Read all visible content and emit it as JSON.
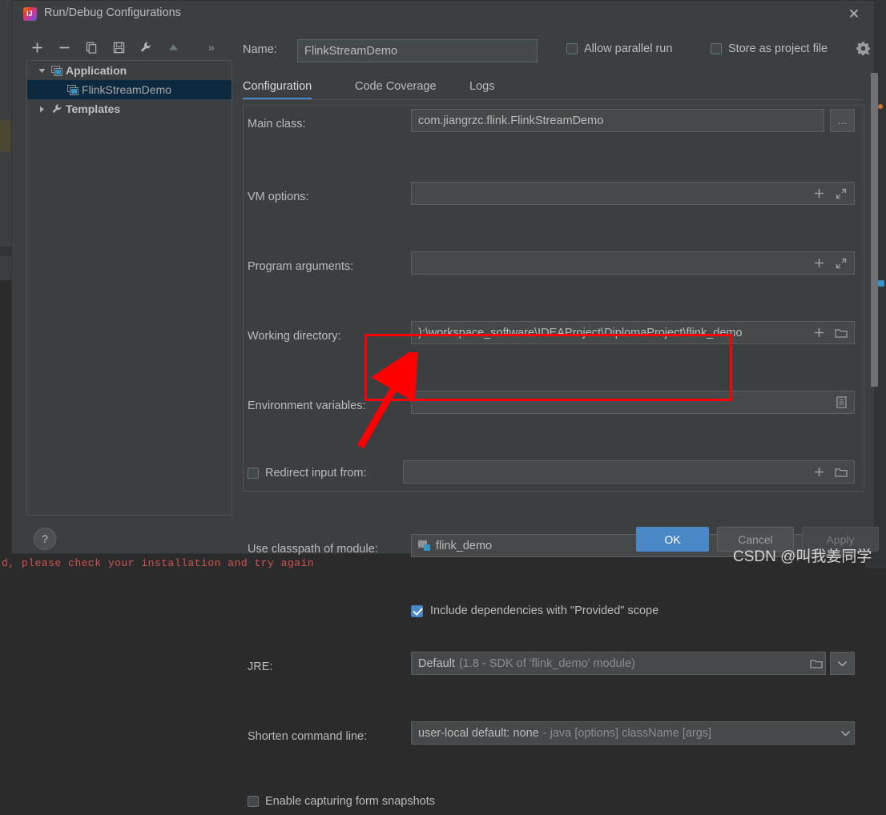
{
  "window": {
    "title": "Run/Debug Configurations",
    "app_icon": "intellij-idea-icon",
    "close_icon": "close-icon"
  },
  "toolbar": {
    "icons": [
      "add-icon",
      "remove-icon",
      "copy-icon",
      "save-icon",
      "wrench-icon",
      "move-up-icon"
    ],
    "overflow_label": "»"
  },
  "tree": {
    "items": [
      {
        "label": "Application",
        "icon": "application-icon",
        "twisty": "expanded",
        "level": 0,
        "selected": false
      },
      {
        "label": "FlinkStreamDemo",
        "icon": "run-config-icon",
        "twisty": "none",
        "level": 1,
        "selected": true
      },
      {
        "label": "Templates",
        "icon": "wrench-icon",
        "twisty": "collapsed",
        "level": 0,
        "selected": false
      }
    ]
  },
  "header": {
    "name_label": "Name:",
    "name_value": "FlinkStreamDemo",
    "allow_parallel_run": {
      "label": "Allow parallel run",
      "checked": false
    },
    "store_as_project_file": {
      "label": "Store as project file",
      "checked": false
    },
    "gear_icon": "gear-icon"
  },
  "tabs": [
    {
      "label": "Configuration",
      "active": true
    },
    {
      "label": "Code Coverage",
      "active": false
    },
    {
      "label": "Logs",
      "active": false
    }
  ],
  "form": {
    "main_class": {
      "label": "Main class:",
      "value": "com.jiangrzc.flink.FlinkStreamDemo",
      "browse_label": "..."
    },
    "vm_options": {
      "label": "VM options:",
      "value": "",
      "icons": [
        "insert-macro-icon",
        "expand-icon"
      ]
    },
    "program_arguments": {
      "label": "Program arguments:",
      "value": "",
      "icons": [
        "insert-macro-icon",
        "expand-icon"
      ]
    },
    "working_directory": {
      "label": "Working directory:",
      "value": "):\\workspace_software\\IDEAProject\\DiplomaProject\\flink_demo",
      "icons": [
        "insert-macro-icon",
        "folder-icon"
      ]
    },
    "environment_variables": {
      "label": "Environment variables:",
      "value": "",
      "icons": [
        "edit-list-icon"
      ]
    },
    "redirect_input": {
      "label": "Redirect input from:",
      "checked": false,
      "value": "",
      "icons": [
        "insert-macro-icon",
        "folder-icon"
      ]
    },
    "use_classpath_of_module": {
      "label": "Use classpath of module:",
      "value": "flink_demo",
      "value_icon": "module-icon",
      "dropdown_icon": "chevron-down-icon"
    },
    "include_provided": {
      "label": "Include dependencies with \"Provided\" scope",
      "checked": true
    },
    "jre": {
      "label": "JRE:",
      "value": "Default",
      "value_hint": "(1.8 - SDK of 'flink_demo' module)",
      "icons": [
        "folder-icon",
        "chevron-down-icon"
      ]
    },
    "shorten_command_line": {
      "label": "Shorten command line:",
      "value": "user-local default: none",
      "value_hint": "- java [options] className [args]",
      "dropdown_icon": "chevron-down-icon"
    },
    "enable_form_snapshots": {
      "label": "Enable capturing form snapshots",
      "checked": false
    }
  },
  "footer": {
    "help_label": "?",
    "ok_label": "OK",
    "cancel_label": "Cancel",
    "apply_label": "Apply"
  },
  "annotations": {
    "highlight_box_color": "#ff0000",
    "arrow_color": "#ff0000",
    "arrow_target": "include-provided-checkbox"
  },
  "background": {
    "console_text": "d, please check your installation and try again"
  },
  "watermark": "CSDN @叫我姜同学",
  "colors": {
    "dialog_bg": "#3c3f41",
    "field_bg": "#45494a",
    "accent": "#4a88c7",
    "selection": "#0d293f",
    "text": "#bbbbbb",
    "annotation": "#ff0000"
  }
}
